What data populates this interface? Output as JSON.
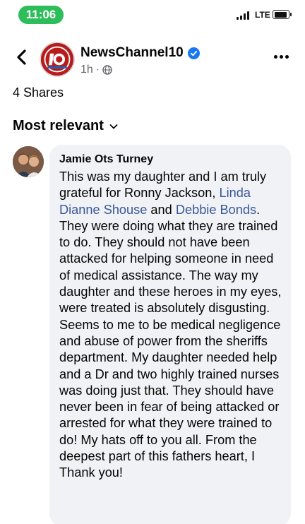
{
  "status_bar": {
    "time": "11:06",
    "network": "LTE"
  },
  "header": {
    "page_name": "NewsChannel10",
    "timestamp": "1h",
    "separator": "·",
    "verified": true,
    "avatar_color": "#b71c1c"
  },
  "post": {
    "shares_label": "4 Shares"
  },
  "comments_section": {
    "sort_label": "Most relevant"
  },
  "comment": {
    "author": "Jamie Ots Turney",
    "text_before": "This was my daughter and I am truly grateful for Ronny Jackson, ",
    "mention_1": "Linda Dianne Shouse",
    "text_middle": " and ",
    "mention_2": "Debbie Bonds",
    "text_after": ". They were doing what they are  trained to do. They should not have been attacked for helping someone in need of medical assistance. The way my daughter and these heroes in my eyes, were treated is absolutely disgusting. Seems to me to be medical negligence and abuse of power from the sheriffs department. My daughter needed help and a Dr and two highly trained nurses was doing just that. They should have never been in fear of being attacked or arrested for what they were trained to do! My hats off to you all. From the deepest part of this fathers heart, I Thank you!"
  },
  "colors": {
    "accent_green": "#2dbd5a",
    "mention_blue": "#385898",
    "verified_blue": "#1877f2",
    "bubble_bg": "#f0f2f5"
  }
}
